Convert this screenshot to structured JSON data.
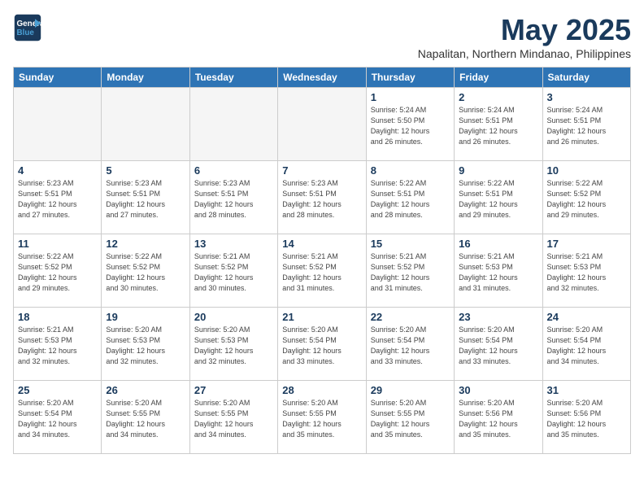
{
  "header": {
    "logo_line1": "General",
    "logo_line2": "Blue",
    "month": "May 2025",
    "location": "Napalitan, Northern Mindanao, Philippines"
  },
  "weekdays": [
    "Sunday",
    "Monday",
    "Tuesday",
    "Wednesday",
    "Thursday",
    "Friday",
    "Saturday"
  ],
  "weeks": [
    [
      {
        "day": "",
        "info": ""
      },
      {
        "day": "",
        "info": ""
      },
      {
        "day": "",
        "info": ""
      },
      {
        "day": "",
        "info": ""
      },
      {
        "day": "1",
        "info": "Sunrise: 5:24 AM\nSunset: 5:50 PM\nDaylight: 12 hours\nand 26 minutes."
      },
      {
        "day": "2",
        "info": "Sunrise: 5:24 AM\nSunset: 5:51 PM\nDaylight: 12 hours\nand 26 minutes."
      },
      {
        "day": "3",
        "info": "Sunrise: 5:24 AM\nSunset: 5:51 PM\nDaylight: 12 hours\nand 26 minutes."
      }
    ],
    [
      {
        "day": "4",
        "info": "Sunrise: 5:23 AM\nSunset: 5:51 PM\nDaylight: 12 hours\nand 27 minutes."
      },
      {
        "day": "5",
        "info": "Sunrise: 5:23 AM\nSunset: 5:51 PM\nDaylight: 12 hours\nand 27 minutes."
      },
      {
        "day": "6",
        "info": "Sunrise: 5:23 AM\nSunset: 5:51 PM\nDaylight: 12 hours\nand 28 minutes."
      },
      {
        "day": "7",
        "info": "Sunrise: 5:23 AM\nSunset: 5:51 PM\nDaylight: 12 hours\nand 28 minutes."
      },
      {
        "day": "8",
        "info": "Sunrise: 5:22 AM\nSunset: 5:51 PM\nDaylight: 12 hours\nand 28 minutes."
      },
      {
        "day": "9",
        "info": "Sunrise: 5:22 AM\nSunset: 5:51 PM\nDaylight: 12 hours\nand 29 minutes."
      },
      {
        "day": "10",
        "info": "Sunrise: 5:22 AM\nSunset: 5:52 PM\nDaylight: 12 hours\nand 29 minutes."
      }
    ],
    [
      {
        "day": "11",
        "info": "Sunrise: 5:22 AM\nSunset: 5:52 PM\nDaylight: 12 hours\nand 29 minutes."
      },
      {
        "day": "12",
        "info": "Sunrise: 5:22 AM\nSunset: 5:52 PM\nDaylight: 12 hours\nand 30 minutes."
      },
      {
        "day": "13",
        "info": "Sunrise: 5:21 AM\nSunset: 5:52 PM\nDaylight: 12 hours\nand 30 minutes."
      },
      {
        "day": "14",
        "info": "Sunrise: 5:21 AM\nSunset: 5:52 PM\nDaylight: 12 hours\nand 31 minutes."
      },
      {
        "day": "15",
        "info": "Sunrise: 5:21 AM\nSunset: 5:52 PM\nDaylight: 12 hours\nand 31 minutes."
      },
      {
        "day": "16",
        "info": "Sunrise: 5:21 AM\nSunset: 5:53 PM\nDaylight: 12 hours\nand 31 minutes."
      },
      {
        "day": "17",
        "info": "Sunrise: 5:21 AM\nSunset: 5:53 PM\nDaylight: 12 hours\nand 32 minutes."
      }
    ],
    [
      {
        "day": "18",
        "info": "Sunrise: 5:21 AM\nSunset: 5:53 PM\nDaylight: 12 hours\nand 32 minutes."
      },
      {
        "day": "19",
        "info": "Sunrise: 5:20 AM\nSunset: 5:53 PM\nDaylight: 12 hours\nand 32 minutes."
      },
      {
        "day": "20",
        "info": "Sunrise: 5:20 AM\nSunset: 5:53 PM\nDaylight: 12 hours\nand 32 minutes."
      },
      {
        "day": "21",
        "info": "Sunrise: 5:20 AM\nSunset: 5:54 PM\nDaylight: 12 hours\nand 33 minutes."
      },
      {
        "day": "22",
        "info": "Sunrise: 5:20 AM\nSunset: 5:54 PM\nDaylight: 12 hours\nand 33 minutes."
      },
      {
        "day": "23",
        "info": "Sunrise: 5:20 AM\nSunset: 5:54 PM\nDaylight: 12 hours\nand 33 minutes."
      },
      {
        "day": "24",
        "info": "Sunrise: 5:20 AM\nSunset: 5:54 PM\nDaylight: 12 hours\nand 34 minutes."
      }
    ],
    [
      {
        "day": "25",
        "info": "Sunrise: 5:20 AM\nSunset: 5:54 PM\nDaylight: 12 hours\nand 34 minutes."
      },
      {
        "day": "26",
        "info": "Sunrise: 5:20 AM\nSunset: 5:55 PM\nDaylight: 12 hours\nand 34 minutes."
      },
      {
        "day": "27",
        "info": "Sunrise: 5:20 AM\nSunset: 5:55 PM\nDaylight: 12 hours\nand 34 minutes."
      },
      {
        "day": "28",
        "info": "Sunrise: 5:20 AM\nSunset: 5:55 PM\nDaylight: 12 hours\nand 35 minutes."
      },
      {
        "day": "29",
        "info": "Sunrise: 5:20 AM\nSunset: 5:55 PM\nDaylight: 12 hours\nand 35 minutes."
      },
      {
        "day": "30",
        "info": "Sunrise: 5:20 AM\nSunset: 5:56 PM\nDaylight: 12 hours\nand 35 minutes."
      },
      {
        "day": "31",
        "info": "Sunrise: 5:20 AM\nSunset: 5:56 PM\nDaylight: 12 hours\nand 35 minutes."
      }
    ]
  ]
}
